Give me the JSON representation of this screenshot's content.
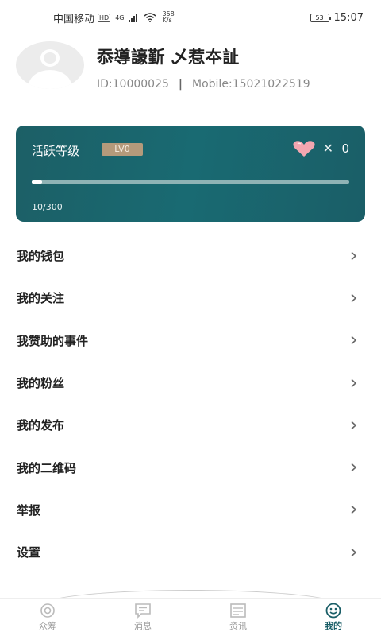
{
  "status_bar": {
    "carrier": "中国移动",
    "hd": "HD",
    "signal": "4G",
    "net_speed_value": "358",
    "net_speed_unit": "K/s",
    "battery": "53",
    "time": "15:07"
  },
  "profile": {
    "username": "忝導譹斳 乄惹夲訨",
    "id_text": "ID:10000025",
    "separator": "|",
    "mobile_text": "Mobile:15021022519"
  },
  "activity": {
    "title": "活跃等级",
    "level": "LV0",
    "heart_count": "0",
    "progress_text": "10/300",
    "progress_fraction": 0.033
  },
  "menu": {
    "items": [
      {
        "label": "我的钱包"
      },
      {
        "label": "我的关注"
      },
      {
        "label": "我赞助的事件"
      },
      {
        "label": "我的粉丝"
      },
      {
        "label": "我的发布"
      },
      {
        "label": "我的二维码"
      },
      {
        "label": "举报"
      },
      {
        "label": "设置"
      }
    ]
  },
  "tabbar": {
    "tabs": [
      {
        "label": "众筹",
        "icon": "crowdfund-icon"
      },
      {
        "label": "消息",
        "icon": "message-icon"
      },
      {
        "label": "资讯",
        "icon": "news-icon"
      },
      {
        "label": "我的",
        "icon": "smile-icon"
      }
    ]
  },
  "colors": {
    "accent": "#1a5e67",
    "badge": "#b49a7b",
    "heart": "#f3a6b0"
  }
}
